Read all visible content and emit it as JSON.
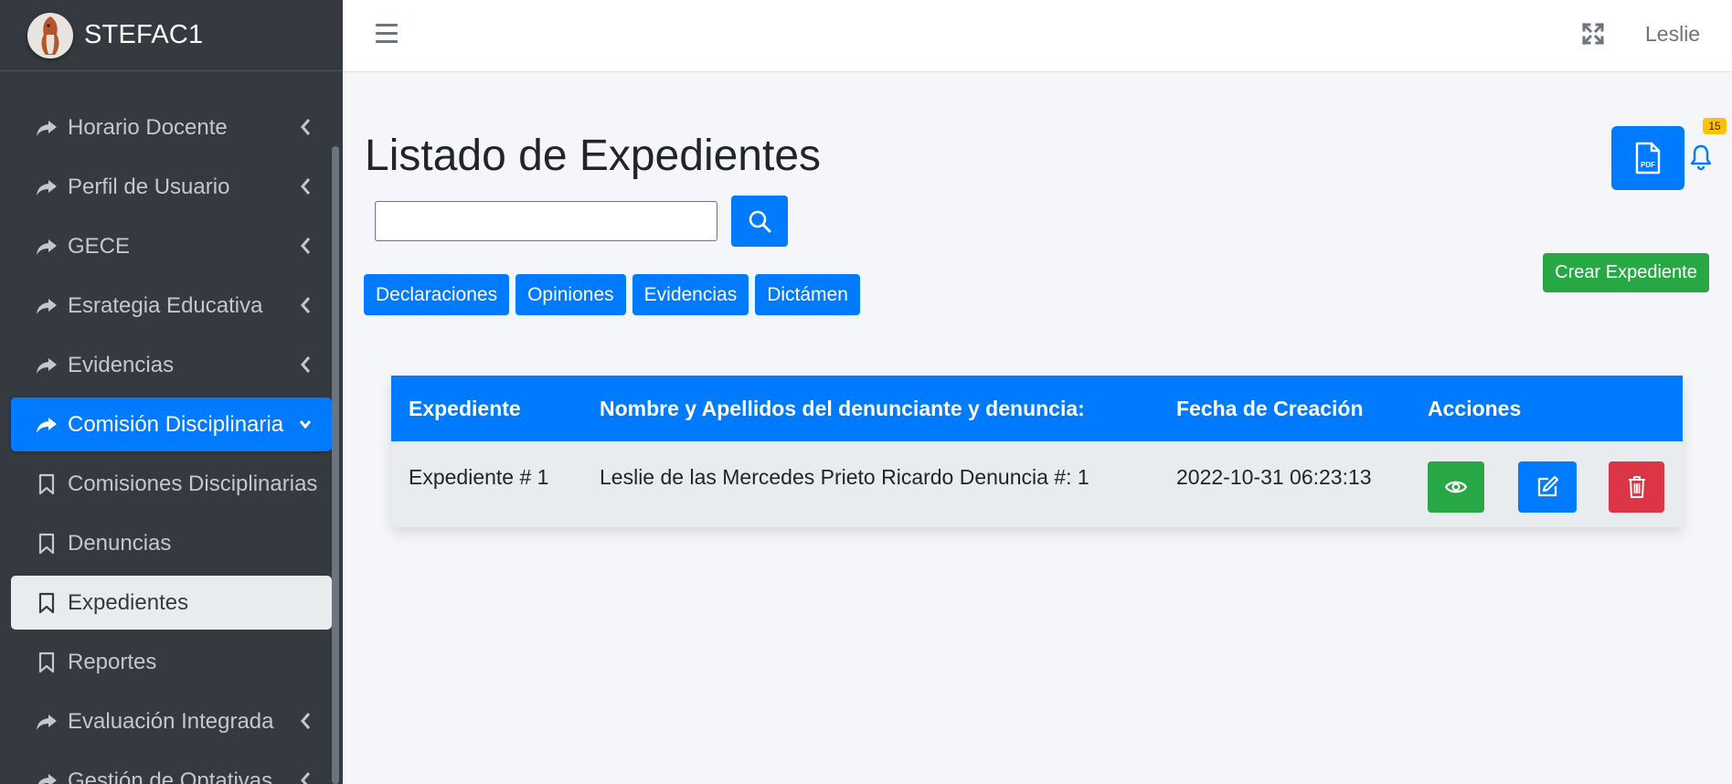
{
  "brand": {
    "prefix": "STE",
    "suffix": "FAC1"
  },
  "header": {
    "user": "Leslie"
  },
  "sidebar": {
    "items": [
      {
        "label": "Horario Docente",
        "icon": "share-arrow-icon",
        "chevron": true
      },
      {
        "label": "Perfil de Usuario",
        "icon": "share-arrow-icon",
        "chevron": true
      },
      {
        "label": "GECE",
        "icon": "share-arrow-icon",
        "chevron": true
      },
      {
        "label": "Esrategia Educativa",
        "icon": "share-arrow-icon",
        "chevron": true
      },
      {
        "label": "Evidencias",
        "icon": "share-arrow-icon",
        "chevron": true
      },
      {
        "label": "Comisión Disciplinaria",
        "icon": "share-arrow-icon",
        "chevron": true,
        "state": "active"
      },
      {
        "label": "Comisiones Disciplinarias",
        "icon": "bookmark-icon"
      },
      {
        "label": "Denuncias",
        "icon": "bookmark-icon"
      },
      {
        "label": "Expedientes",
        "icon": "bookmark-icon",
        "state": "selected"
      },
      {
        "label": "Reportes",
        "icon": "bookmark-icon"
      },
      {
        "label": "Evaluación Integrada",
        "icon": "share-arrow-icon",
        "chevron": true
      },
      {
        "label": "Gestión de Optativas",
        "icon": "share-arrow-icon",
        "chevron": true
      }
    ]
  },
  "main": {
    "title": "Listado de Expedientes",
    "search": {
      "value": "",
      "placeholder": ""
    },
    "tabs": [
      "Declaraciones",
      "Opiniones",
      "Evidencias",
      "Dictámen"
    ],
    "pdf_label": "PDF",
    "notifications": "15",
    "create_button": "Crear Expediente",
    "table": {
      "headers": [
        "Expediente",
        "Nombre y Apellidos del denunciante y denuncia:",
        "Fecha de Creación",
        "Acciones"
      ],
      "rows": [
        {
          "expediente": "Expediente # 1",
          "nombre": "Leslie de las Mercedes Prieto Ricardo Denuncia #: 1",
          "fecha": "2022-10-31 06:23:13"
        }
      ]
    }
  },
  "colors": {
    "primary": "#007bff",
    "success": "#28a745",
    "danger": "#dc3545",
    "sidebar": "#343a40",
    "badge": "#ffc107"
  }
}
